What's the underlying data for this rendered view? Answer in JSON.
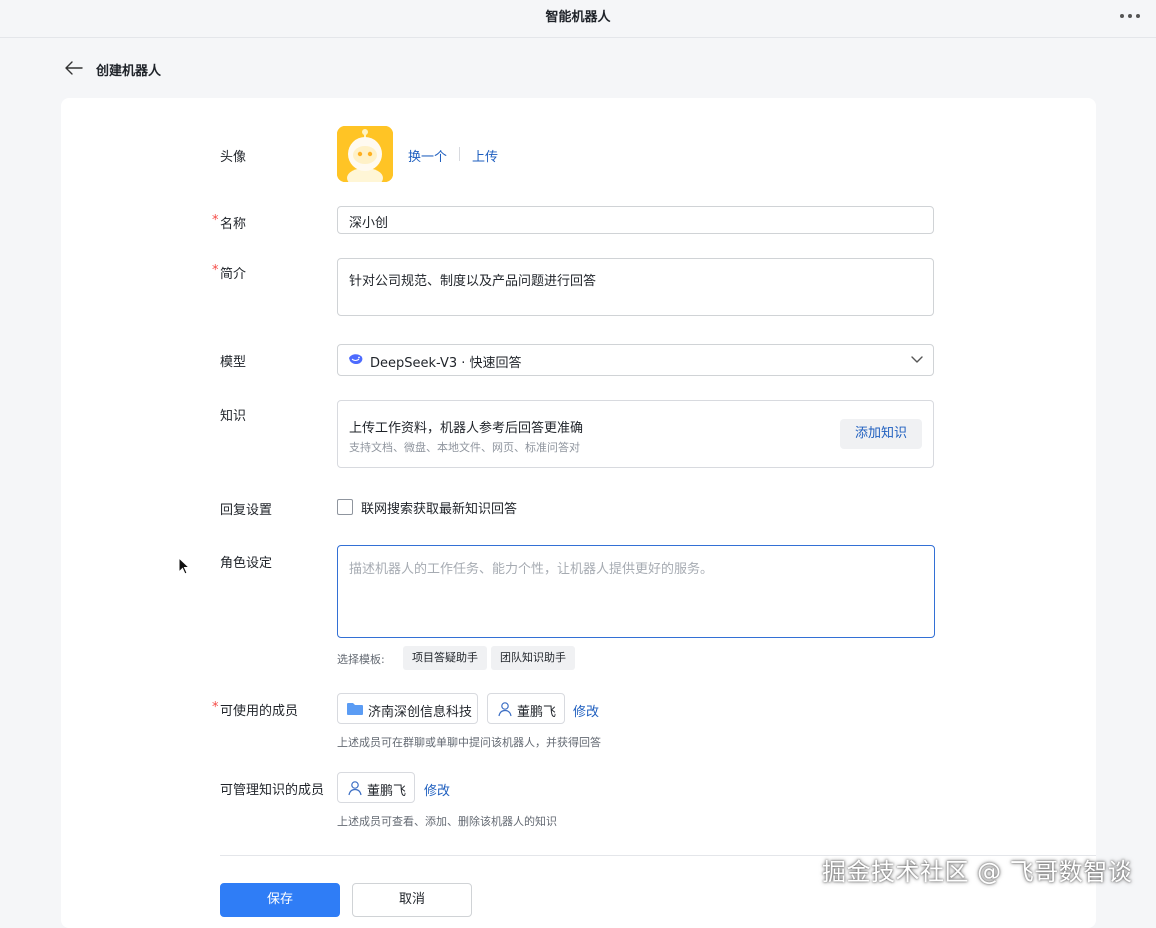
{
  "window": {
    "title": "智能机器人",
    "more_icon": "more-horizontal-icon"
  },
  "page": {
    "title": "创建机器人",
    "back_icon": "arrow-left-icon"
  },
  "form": {
    "avatar": {
      "label": "头像",
      "change_label": "换一个",
      "upload_label": "上传",
      "icon": "robot-avatar-icon",
      "color": "#ffc425"
    },
    "name": {
      "label": "名称",
      "required": "*",
      "value": "深小创"
    },
    "intro": {
      "label": "简介",
      "required": "*",
      "value": "针对公司规范、制度以及产品问题进行回答"
    },
    "model": {
      "label": "模型",
      "value": "DeepSeek-V3 · 快速回答",
      "icon": "deepseek-whale-icon"
    },
    "knowledge": {
      "label": "知识",
      "title": "上传工作资料，机器人参考后回答更准确",
      "subtitle": "支持文档、微盘、本地文件、网页、标准问答对",
      "add_label": "添加知识"
    },
    "reply": {
      "label": "回复设置",
      "checkbox_label": "联网搜索获取最新知识回答",
      "checked": false
    },
    "role": {
      "label": "角色设定",
      "placeholder": "描述机器人的工作任务、能力个性，让机器人提供更好的服务。",
      "template_label": "选择模板:",
      "templates": [
        "项目答疑助手",
        "团队知识助手"
      ]
    },
    "members": {
      "label": "可使用的成员",
      "required": "*",
      "items": [
        "济南深创信息科技",
        "董鹏飞"
      ],
      "edit_label": "修改",
      "hint": "上述成员可在群聊或单聊中提问该机器人，并获得回答"
    },
    "managers": {
      "label": "可管理知识的成员",
      "items": [
        "董鹏飞"
      ],
      "edit_label": "修改",
      "hint": "上述成员可查看、添加、删除该机器人的知识"
    }
  },
  "actions": {
    "save_label": "保存",
    "cancel_label": "取消"
  },
  "watermark": "掘金技术社区 @ 飞哥数智谈",
  "colors": {
    "primary": "#2f7df6",
    "link": "#1f5fbf",
    "required": "#f54a45",
    "focus_border": "#3370d5"
  }
}
